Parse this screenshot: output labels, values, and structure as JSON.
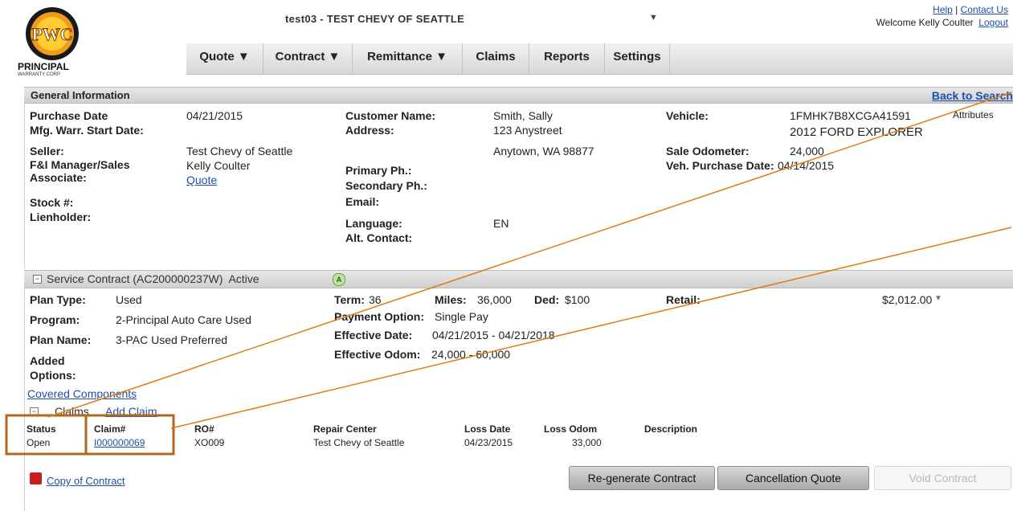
{
  "header": {
    "logo_text": "PWC",
    "logo_caption": "PRINCIPAL",
    "logo_subcaption": "WARRANTY CORP",
    "site_title": "test03 - TEST CHEVY OF SEATTLE",
    "help_link": "Help",
    "contact_link": "Contact Us",
    "welcome": "Welcome Kelly Coulter",
    "logout": "Logout"
  },
  "nav": [
    {
      "label": "Quote ▼"
    },
    {
      "label": "Contract ▼"
    },
    {
      "label": "Remittance ▼"
    },
    {
      "label": "Claims"
    },
    {
      "label": "Reports"
    },
    {
      "label": "Settings"
    }
  ],
  "general": {
    "header": "General Information",
    "back_link": "Back to Search",
    "purchase_date_label": "Purchase Date",
    "purchase_date": "04/21/2015",
    "mfg_label": "Mfg. Warr. Start Date:",
    "seller_label": "Seller:",
    "seller": "Test Chevy of Seattle",
    "fi_label": "F&I Manager/Sales Associate:",
    "fi_value": "Kelly Coulter",
    "fi_link": "Quote",
    "stock_label": "Stock #:",
    "lienholder_label": "Lienholder:",
    "customer_label": "Customer Name:",
    "customer": "Smith, Sally",
    "address_label": "Address:",
    "address1": "123 Anystreet",
    "address2": "Anytown, WA 98877",
    "primary_label": "Primary Ph.:",
    "secondary_label": "Secondary Ph.:",
    "email_label": "Email:",
    "language_label": "Language:",
    "language": "EN",
    "alt_label": "Alt. Contact:",
    "vehicle_label": "Vehicle:",
    "vin": "1FMHK7B8XCGA41591",
    "attributes": "Attributes",
    "vehicle_desc": "2012 FORD EXPLORER",
    "odometer_label": "Sale Odometer:",
    "odometer": "24,000",
    "veh_purchase_label": "Veh. Purchase Date:",
    "veh_purchase": "04/14/2015"
  },
  "service": {
    "toggle": "−",
    "header": "Service Contract (AC200000237W)  Active",
    "status_badge": "A",
    "plan_type_label": "Plan Type:",
    "plan_type": "Used",
    "program_label": "Program:",
    "program": "2-Principal Auto Care Used",
    "plan_name_label": "Plan Name:",
    "plan_name": "3-PAC Used Preferred",
    "added_options_label": "Added Options:",
    "covered_link": "Covered Components",
    "term_label": "Term:",
    "term": "36",
    "miles_label": "Miles:",
    "miles": "36,000",
    "ded_label": "Ded:",
    "ded": "$100",
    "payment_label": "Payment Option:",
    "payment": "Single Pay",
    "effective_label": "Effective Date:",
    "effective": "04/21/2015 - 04/21/2018",
    "odom_label": "Effective Odom:",
    "odom": "24,000 - 60,000",
    "retail_label": "Retail:",
    "retail": "$2,012.00",
    "retail_caret": "▼"
  },
  "claims": {
    "toggle": "−",
    "title": "Claims",
    "add_link": "Add Claim",
    "columns": [
      "Status",
      "Claim#",
      "RO#",
      "Repair Center",
      "Loss Date",
      "Loss Odom",
      "Description"
    ],
    "rows": [
      {
        "status": "Open",
        "claim": "I000000069",
        "ro": "XO009",
        "center": "Test Chevy of Seattle",
        "loss_date": "04/23/2015",
        "loss_odom": "33,000",
        "description": ""
      }
    ]
  },
  "footer": {
    "copy_link": "Copy of Contract",
    "regen_button": "Re-generate Contract",
    "cancel_button": "Cancellation Quote",
    "void_button": "Void Contract"
  },
  "colors": {
    "annotation": "#e07b13",
    "highlight_box": "#b5651d",
    "link": "#1f4fa8"
  }
}
